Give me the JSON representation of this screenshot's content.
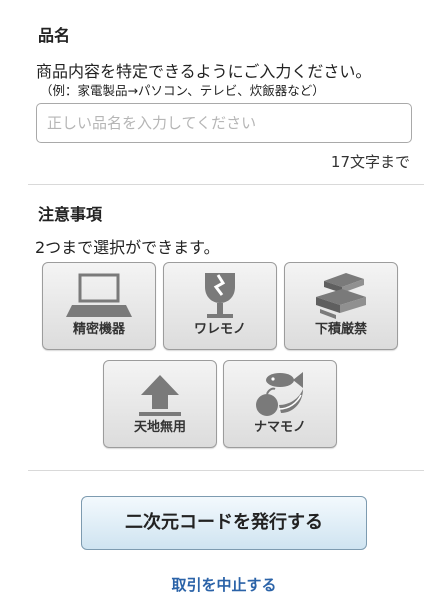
{
  "item_name": {
    "title": "品名",
    "description": "商品内容を特定できるようにご入力ください。",
    "example": "（例：家電製品→パソコン、テレビ、炊飯器など）",
    "input_value": "",
    "input_placeholder": "正しい品名を入力してください",
    "limit_text": "17文字まで"
  },
  "notes": {
    "title": "注意事項",
    "instruction": "2つまで選択ができます。",
    "options": [
      {
        "label": "精密機器",
        "icon": "laptop-icon"
      },
      {
        "label": "ワレモノ",
        "icon": "broken-glass-icon"
      },
      {
        "label": "下積厳禁",
        "icon": "stack-icon"
      },
      {
        "label": "天地無用",
        "icon": "up-arrow-icon"
      },
      {
        "label": "ナマモノ",
        "icon": "perishable-food-icon"
      }
    ]
  },
  "actions": {
    "issue_code_label": "二次元コードを発行する",
    "cancel_label": "取引を中止する"
  },
  "colors": {
    "link": "#2b63a8",
    "icon": "#7a7a7a",
    "button_border": "#7d9bb0"
  }
}
